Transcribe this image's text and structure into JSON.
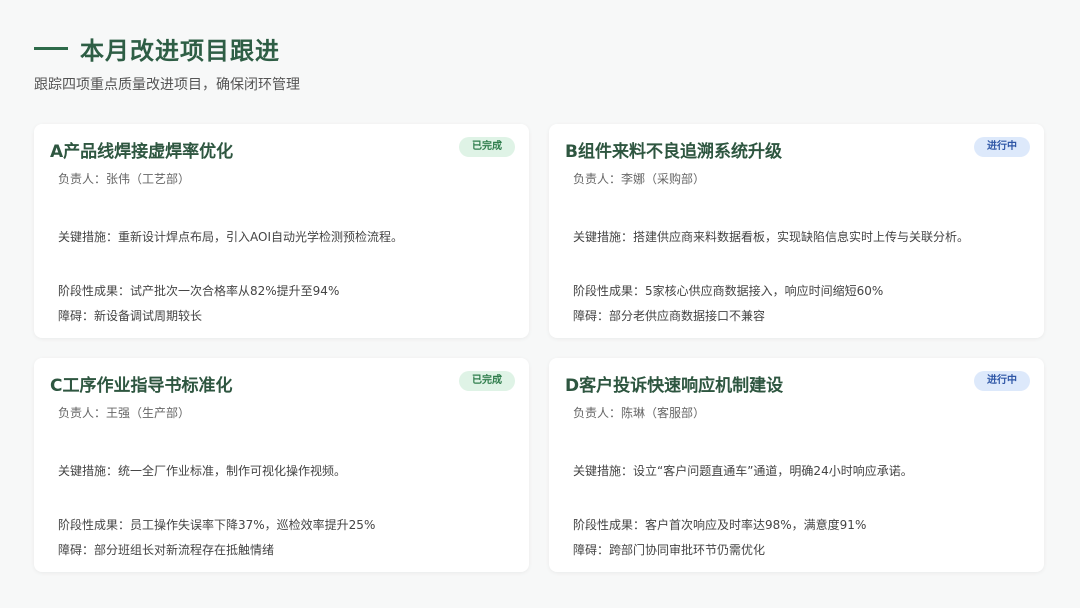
{
  "header": {
    "title": "本月改进项目跟进",
    "subtitle": "跟踪四项重点质量改进项目，确保闭环管理"
  },
  "cards": [
    {
      "title": "A产品线焊接虚焊率优化",
      "status": "已完成",
      "owner": "负责人：张伟（工艺部）",
      "measures": "关键措施：重新设计焊点布局，引入AOI自动光学检测预检流程。",
      "result": "阶段性成果：试产批次一次合格率从82%提升至94%",
      "obstacle": "障碍：新设备调试周期较长"
    },
    {
      "title": "B组件来料不良追溯系统升级",
      "status": "进行中",
      "owner": "负责人：李娜（采购部）",
      "measures": "关键措施：搭建供应商来料数据看板，实现缺陷信息实时上传与关联分析。",
      "result": "阶段性成果：5家核心供应商数据接入，响应时间缩短60%",
      "obstacle": "障碍：部分老供应商数据接口不兼容"
    },
    {
      "title": "C工序作业指导书标准化",
      "status": "已完成",
      "owner": "负责人：王强（生产部）",
      "measures": "关键措施：统一全厂作业标准，制作可视化操作视频。",
      "result": "阶段性成果：员工操作失误率下降37%，巡检效率提升25%",
      "obstacle": "障碍：部分班组长对新流程存在抵触情绪"
    },
    {
      "title": "D客户投诉快速响应机制建设",
      "status": "进行中",
      "owner": "负责人：陈琳（客服部）",
      "measures": "关键措施：设立“客户问题直通车”通道，明确24小时响应承诺。",
      "result": "阶段性成果：客户首次响应及时率达98%，满意度91%",
      "obstacle": "障碍：跨部门协同审批环节仍需优化"
    }
  ],
  "colors": {
    "accent": "#2e6b4a",
    "done_bg": "#dff3e6",
    "done_text": "#2f7d4c",
    "progress_bg": "#dde9fb",
    "progress_text": "#2e56a6"
  }
}
